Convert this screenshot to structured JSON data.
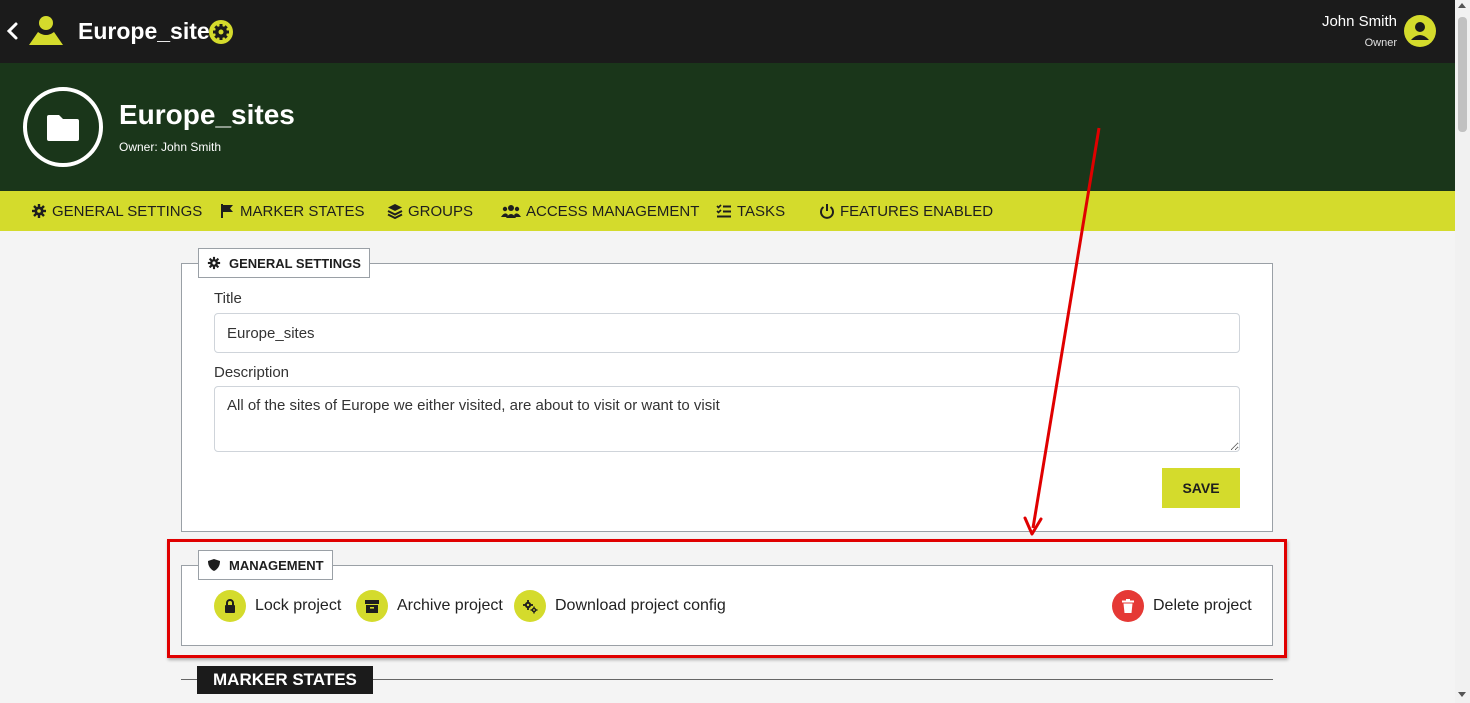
{
  "header": {
    "back_icon": "chevron-left-icon",
    "logo_icon": "app-logo-icon",
    "project_title": "Europe_sites",
    "settings_icon": "gear-icon",
    "user_name": "John Smith",
    "user_role": "Owner",
    "avatar_icon": "user-circle-icon"
  },
  "hero": {
    "icon": "folder-icon",
    "title": "Europe_sites",
    "owner_line": "Owner: John Smith"
  },
  "tabs": [
    {
      "label": "General Settings",
      "icon": "gear-icon"
    },
    {
      "label": "Marker States",
      "icon": "flag-icon"
    },
    {
      "label": "Groups",
      "icon": "layers-icon"
    },
    {
      "label": "Access Management",
      "icon": "users-icon"
    },
    {
      "label": "Tasks",
      "icon": "checklist-icon"
    },
    {
      "label": "Features Enabled",
      "icon": "power-icon"
    }
  ],
  "general_settings": {
    "legend": "General Settings",
    "title_label": "Title",
    "title_value": "Europe_sites",
    "description_label": "Description",
    "description_value": "All of the sites of Europe we either visited, are about to visit or want to visit",
    "save_label": "SAVE"
  },
  "management": {
    "legend": "Management",
    "actions": [
      {
        "label": "Lock project",
        "icon": "lock-icon"
      },
      {
        "label": "Archive project",
        "icon": "archive-icon"
      },
      {
        "label": "Download project config",
        "icon": "cogs-icon"
      },
      {
        "label": "Delete project",
        "icon": "trash-icon"
      }
    ]
  },
  "marker_states": {
    "title": "Marker States"
  },
  "colors": {
    "accent": "#d4db2c",
    "topbar": "#1b1b1b",
    "hero": "#1a361a",
    "danger": "#e53935",
    "annotation": "#e00000"
  }
}
